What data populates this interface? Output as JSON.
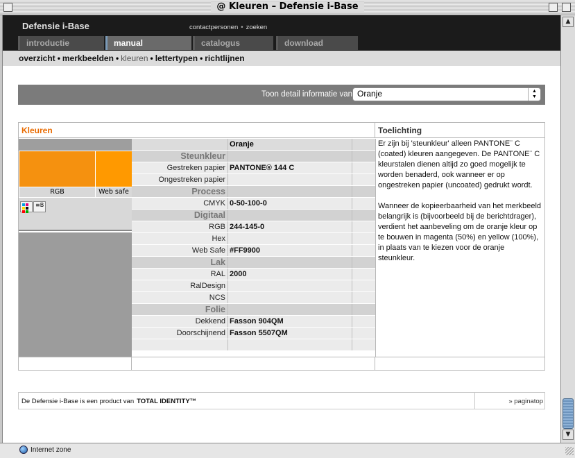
{
  "window": {
    "title": "Kleuren – Defensie i-Base"
  },
  "header": {
    "brand": "Defensie i-Base",
    "links": [
      "contactpersonen",
      "zoeken"
    ],
    "tabs": [
      "introductie",
      "manual",
      "catalogus",
      "download"
    ],
    "active_tab": "manual"
  },
  "subnav": {
    "items": [
      "overzicht",
      "merkbeelden",
      "kleuren",
      "lettertypen",
      "richtlijnen"
    ],
    "current": "kleuren"
  },
  "filter": {
    "label": "Toon detail informatie van:",
    "selected": "Oranje"
  },
  "colors_table": {
    "left_header": "Kleuren",
    "right_header": "Toelichting",
    "swatch_labels": [
      "RGB",
      "Web safe"
    ],
    "swatch_colors": {
      "rgb": "#f5910f",
      "web_safe": "#ff9900"
    },
    "icon_b_label": "B",
    "column_header": "Oranje",
    "rows": [
      {
        "type": "group",
        "label": "Steunkleur"
      },
      {
        "type": "data",
        "label": "Gestreken papier",
        "value": "PANTONE® 144 C"
      },
      {
        "type": "data",
        "label": "Ongestreken papier",
        "value": ""
      },
      {
        "type": "group",
        "label": "Process"
      },
      {
        "type": "data",
        "label": "CMYK",
        "value": "0-50-100-0"
      },
      {
        "type": "group",
        "label": "Digitaal"
      },
      {
        "type": "data",
        "label": "RGB",
        "value": "244-145-0"
      },
      {
        "type": "data",
        "label": "Hex",
        "value": ""
      },
      {
        "type": "data",
        "label": "Web Safe",
        "value": "#FF9900"
      },
      {
        "type": "group",
        "label": "Lak"
      },
      {
        "type": "data",
        "label": "RAL",
        "value": "2000"
      },
      {
        "type": "data",
        "label": "RalDesign",
        "value": ""
      },
      {
        "type": "data",
        "label": "NCS",
        "value": ""
      },
      {
        "type": "group",
        "label": "Folie"
      },
      {
        "type": "data",
        "label": "Dekkend",
        "value": "Fasson 904QM"
      },
      {
        "type": "data",
        "label": "Doorschijnend",
        "value": "Fasson 5507QM"
      },
      {
        "type": "data",
        "label": "",
        "value": ""
      }
    ],
    "toelichting": [
      "Er zijn bij 'steunkleur' alleen PANTONE¨ C (coated) kleuren aangegeven. De PANTONE¨ C kleurstalen dienen altijd zo goed mogelijk te worden benaderd, ook wanneer er op ongestreken papier (uncoated) gedrukt wordt.",
      "Wanneer de kopieerbaarheid van het merkbeeld belangrijk is (bijvoorbeeld bij de berichtdrager), verdient het aanbeveling om de oranje kleur op te bouwen in magenta (50%) en yellow (100%), in plaats van te kiezen voor de oranje steunkleur."
    ]
  },
  "footer": {
    "text": "De Defensie i-Base is een product van",
    "brand": "TOTAL IDENTITY™",
    "top_link": "» paginatop"
  },
  "statusbar": {
    "zone": "Internet zone"
  },
  "accent_color": "#e96b00"
}
